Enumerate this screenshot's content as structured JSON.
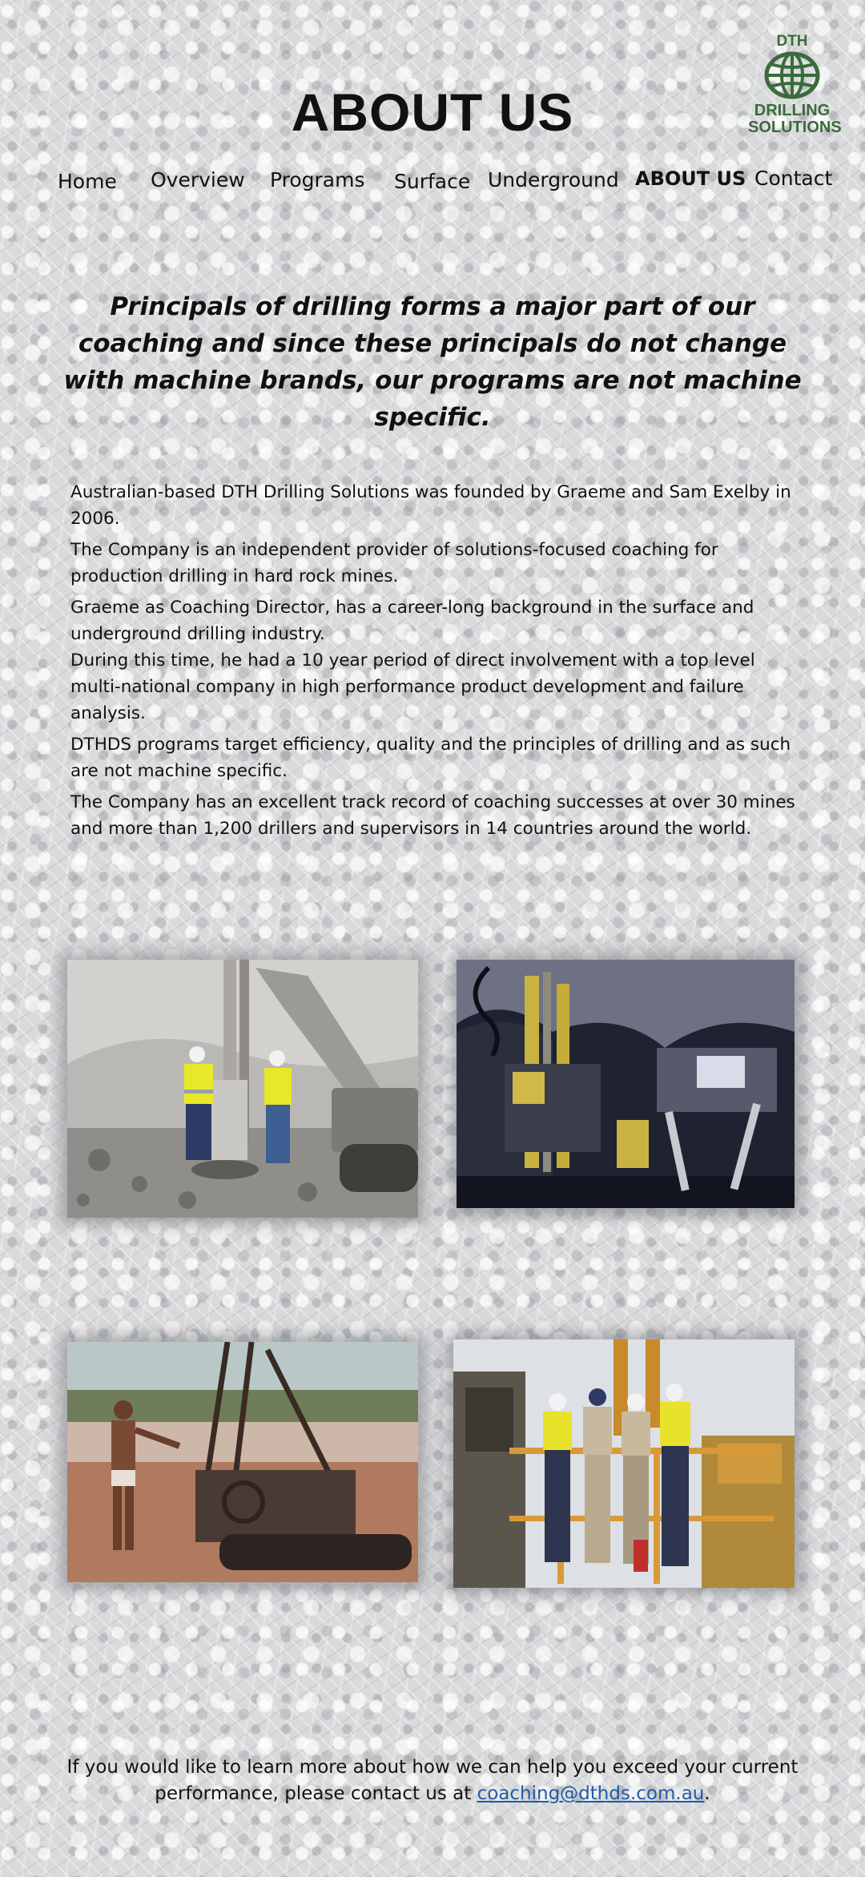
{
  "logo": {
    "top": "DTH",
    "bottom_line1": "DRILLING",
    "bottom_line2": "SOLUTIONS",
    "icon": "globe-icon",
    "color": "#3a6b3a"
  },
  "page": {
    "title": "ABOUT US"
  },
  "nav": {
    "items": [
      {
        "label": "Home"
      },
      {
        "label": "Overview"
      },
      {
        "label": "Programs"
      },
      {
        "label": "Surface"
      },
      {
        "label": "Underground"
      },
      {
        "label": "ABOUT US",
        "active": true
      },
      {
        "label": "Contact"
      }
    ]
  },
  "tagline": "Principals of drilling forms a major part of our coaching and since these principals do not change with machine brands, our programs are not machine specific.",
  "about": {
    "p1": "Australian-based DTH Drilling Solutions was founded by Graeme and Sam Exelby in 2006.",
    "p2": "The Company is an independent provider of solutions-focused coaching for production drilling in hard rock mines.",
    "p3": "Graeme as Coaching Director, has a career-long background in the surface and underground drilling industry.",
    "p4": "During this time, he had a 10 year period of direct involvement with a top level multi-national company in high performance product development and failure analysis.",
    "p5": "DTHDS programs target efficiency, quality and the principles of drilling and as such are not machine specific.",
    "p6": "The Company has an excellent track record of coaching successes at over 30 mines and more than 1,200 drillers and supervisors in 14 countries around the world."
  },
  "footer": {
    "text_before": "If you would like to learn more about how we can help you exceed your current performance, please contact us at ",
    "email": "coaching@dthds.com.au",
    "text_after": ".",
    "link_color": "#1f5ca8"
  }
}
